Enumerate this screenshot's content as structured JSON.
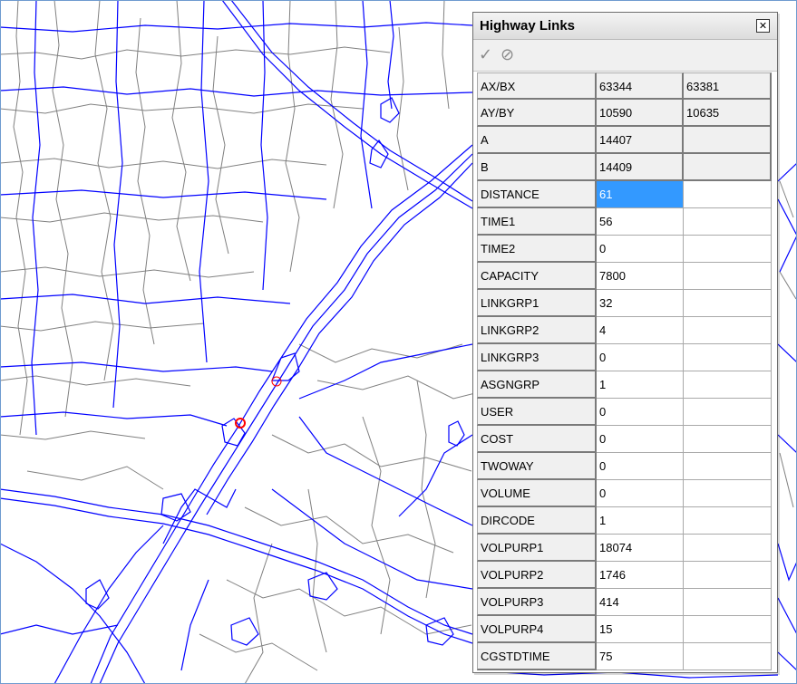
{
  "window": {
    "title": "Highway Links",
    "close_glyph": "✕",
    "toolbar": [
      {
        "icon": "checkmark-icon",
        "glyph": "✓"
      },
      {
        "icon": "no-edit-icon",
        "glyph": "⊘"
      }
    ]
  },
  "rows": [
    {
      "name": "AX/BX",
      "v1": "63344",
      "v2": "63381",
      "readonly": true
    },
    {
      "name": "AY/BY",
      "v1": "10590",
      "v2": "10635",
      "readonly": true
    },
    {
      "name": "A",
      "v1": "14407",
      "v2": "",
      "readonly": true
    },
    {
      "name": "B",
      "v1": "14409",
      "v2": "",
      "readonly": true
    },
    {
      "name": "DISTANCE",
      "v1": "61",
      "v2": "",
      "selected": true
    },
    {
      "name": "TIME1",
      "v1": "56",
      "v2": ""
    },
    {
      "name": "TIME2",
      "v1": "0",
      "v2": ""
    },
    {
      "name": "CAPACITY",
      "v1": "7800",
      "v2": ""
    },
    {
      "name": "LINKGRP1",
      "v1": "32",
      "v2": ""
    },
    {
      "name": "LINKGRP2",
      "v1": "4",
      "v2": ""
    },
    {
      "name": "LINKGRP3",
      "v1": "0",
      "v2": ""
    },
    {
      "name": "ASGNGRP",
      "v1": "1",
      "v2": ""
    },
    {
      "name": "USER",
      "v1": "0",
      "v2": ""
    },
    {
      "name": "COST",
      "v1": "0",
      "v2": ""
    },
    {
      "name": "TWOWAY",
      "v1": "0",
      "v2": ""
    },
    {
      "name": "VOLUME",
      "v1": "0",
      "v2": ""
    },
    {
      "name": "DIRCODE",
      "v1": "1",
      "v2": ""
    },
    {
      "name": "VOLPURP1",
      "v1": "18074",
      "v2": ""
    },
    {
      "name": "VOLPURP2",
      "v1": "1746",
      "v2": ""
    },
    {
      "name": "VOLPURP3",
      "v1": "414",
      "v2": ""
    },
    {
      "name": "VOLPURP4",
      "v1": "15",
      "v2": ""
    },
    {
      "name": "CGSTDTIME",
      "v1": "75",
      "v2": ""
    }
  ],
  "colors": {
    "highway": "#0000ff",
    "local_road": "#808080",
    "selected_node": "#ff0000",
    "selection": "#3399ff"
  }
}
